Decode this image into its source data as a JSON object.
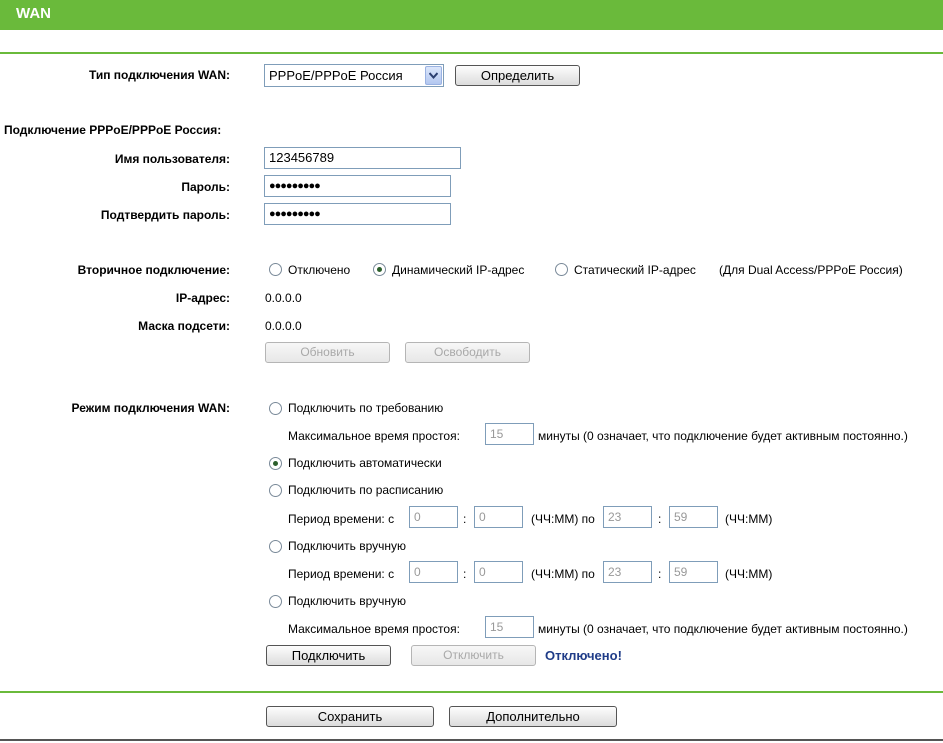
{
  "header": {
    "title": "WAN"
  },
  "wan_type": {
    "label": "Тип подключения WAN:",
    "selected": "PPPoE/PPPoE Россия",
    "detect_button": "Определить"
  },
  "pppoe": {
    "section_label": "Подключение PPPoE/PPPoE Россия:",
    "username_label": "Имя пользователя:",
    "username_value": "123456789",
    "password_label": "Пароль:",
    "password_value": "●●●●●●●●●",
    "confirm_label": "Подтвердить пароль:",
    "confirm_value": "●●●●●●●●●"
  },
  "secondary": {
    "label": "Вторичное подключение:",
    "options": [
      "Отключено",
      "Динамический IP-адрес",
      "Статический IP-адрес"
    ],
    "selected_index": 1,
    "note": "(Для Dual Access/PPPoE Россия)",
    "ip_label": "IP-адрес:",
    "ip_value": "0.0.0.0",
    "mask_label": "Маска подсети:",
    "mask_value": "0.0.0.0",
    "refresh_button": "Обновить",
    "release_button": "Освободить"
  },
  "mode": {
    "label": "Режим подключения WAN:",
    "on_demand": "Подключить по требованию",
    "idle_label": "Максимальное время простоя:",
    "idle_value": "15",
    "idle_suffix": "минуты (0 означает, что подключение будет активным постоянно.)",
    "auto": "Подключить автоматически",
    "schedule": "Подключить по расписанию",
    "period_label": "Период времени: с",
    "period_from_h": "0",
    "period_from_m": "0",
    "hhmm_to": "(ЧЧ:ММ) по",
    "period_to_h": "23",
    "period_to_m": "59",
    "hhmm": "(ЧЧ:ММ)",
    "manual1": "Подключить вручную",
    "period2_from_h": "0",
    "period2_from_m": "0",
    "period2_to_h": "23",
    "period2_to_m": "59",
    "manual2": "Подключить вручную",
    "idle2_value": "15",
    "selected": "auto",
    "connect_button": "Подключить",
    "disconnect_button": "Отключить",
    "status": "Отключено!",
    "colon": ":"
  },
  "footer": {
    "save_button": "Сохранить",
    "advanced_button": "Дополнительно"
  },
  "colors": {
    "accent": "#6aba3b",
    "status": "#1f3c88"
  }
}
